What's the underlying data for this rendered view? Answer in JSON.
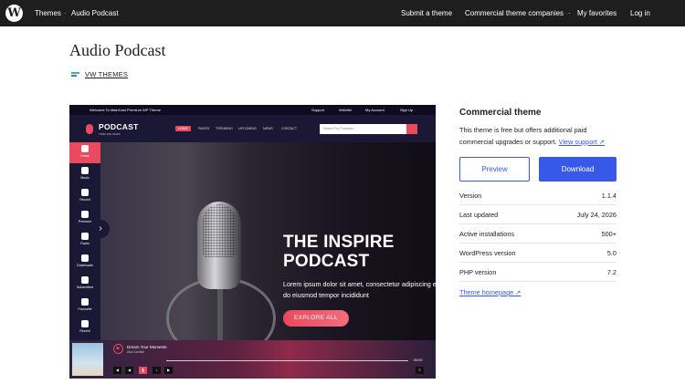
{
  "topbar": {
    "logo": "W",
    "breadcrumb": [
      "Themes",
      "Audio Podcast"
    ],
    "nav": [
      "Submit a theme",
      "Commercial theme companies",
      "My favorites",
      "Log in"
    ]
  },
  "page": {
    "title": "Audio Podcast",
    "author": "VW THEMES"
  },
  "preview": {
    "top_bar_left": "Welcome To MainCast Premium WP Theme",
    "top_bar_right": [
      "Support",
      "Wishlist",
      "My Account",
      "Sign Up"
    ],
    "logo": "PODCAST",
    "logo_sub": "TIMELINE NEWS",
    "menu": [
      "HOME",
      "PAGES",
      "TRENDING",
      "UPCOMING",
      "NEWS",
      "CONTACT"
    ],
    "search_placeholder": "Search For Podcasts...",
    "sidebar": [
      "Home",
      "Music",
      "Record",
      "Premium",
      "Radio",
      "Downloads",
      "Subscribed",
      "Favourite",
      "Recent"
    ],
    "hero_title_1": "THE INSPIRE",
    "hero_title_2": "PODCAST",
    "hero_text": "Lorem ipsum dolor sit amet, consectetur adipiscing elit, sed do eiusmod tempor incididunt",
    "hero_button": "EXPLORE ALL",
    "player_song": "Dream Your Moments",
    "player_artist": "Ava Cornish",
    "player_time": "00:00"
  },
  "sidebar": {
    "title": "Commercial theme",
    "description": "This theme is free but offers additional paid commercial upgrades or support.",
    "support_link": "View support ↗",
    "preview_button": "Preview",
    "download_button": "Download",
    "meta": [
      {
        "key": "Version",
        "value": "1.1.4"
      },
      {
        "key": "Last updated",
        "value": "July 24, 2026"
      },
      {
        "key": "Active installations",
        "value": "500+"
      },
      {
        "key": "WordPress version",
        "value": "5.0"
      },
      {
        "key": "PHP version",
        "value": "7.2"
      }
    ],
    "homepage_link": "Theme homepage ↗"
  },
  "colors": {
    "accent": "#3858e9",
    "topbar": "#1e1e1e",
    "preview_accent": "#e94a5d"
  }
}
